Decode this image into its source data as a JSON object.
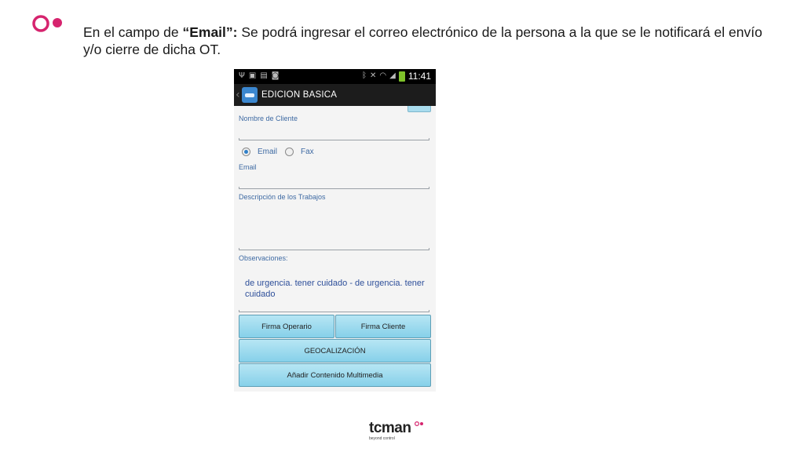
{
  "slide": {
    "heading_prefix": "En el campo de ",
    "heading_bold": "“Email”:",
    "heading_rest": " Se podrá ingresar el correo electrónico de la persona a la que se le notificará el envío y/o cierre de dicha OT."
  },
  "statusbar": {
    "time": "11:41"
  },
  "actionbar": {
    "title": "EDICION BASICA"
  },
  "form": {
    "client_label": "Nombre de Cliente",
    "radio_email": "Email",
    "radio_fax": "Fax",
    "selected": "Email",
    "email_label": "Email",
    "work_label": "Descripción de los Trabajos",
    "obs_label": "Observaciones:",
    "obs_value": "de urgencia. tener cuidado - de urgencia. tener cuidado"
  },
  "buttons": {
    "firma_operario": "Firma Operario",
    "firma_cliente": "Firma Cliente",
    "geolocalizacion": "GEOCALIZACIÓN",
    "multimedia": "Añadir Contenido Multimedia"
  },
  "footer": {
    "brand": "tcman",
    "tagline": "beyond control"
  },
  "colors": {
    "accent_pink": "#d6246e",
    "button_blue": "#9bd9ee",
    "label_blue": "#3e6aa3"
  }
}
